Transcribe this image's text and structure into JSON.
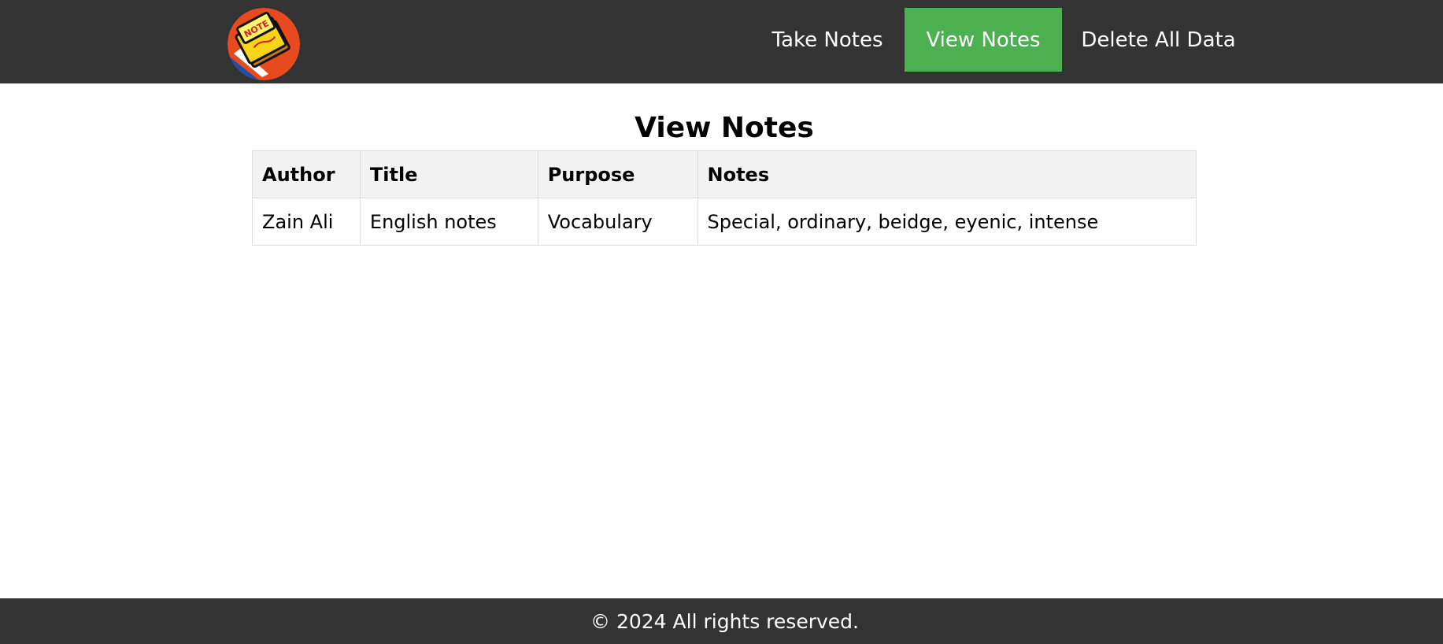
{
  "header": {
    "logo_icon": "notes-logo-icon",
    "nav": [
      {
        "label": "Take Notes",
        "active": false
      },
      {
        "label": "View Notes",
        "active": true
      },
      {
        "label": "Delete All Data",
        "active": false
      }
    ],
    "colors": {
      "bar": "#333333",
      "active": "#4caf50",
      "link": "#ffffff"
    }
  },
  "main": {
    "title": "View Notes",
    "table": {
      "headers": [
        "Author",
        "Title",
        "Purpose",
        "Notes"
      ],
      "rows": [
        [
          "Zain Ali",
          "English notes",
          "Vocabulary",
          "Special, ordinary, beidge, eyenic, intense"
        ]
      ]
    }
  },
  "footer": {
    "text": "© 2024 All rights reserved."
  }
}
